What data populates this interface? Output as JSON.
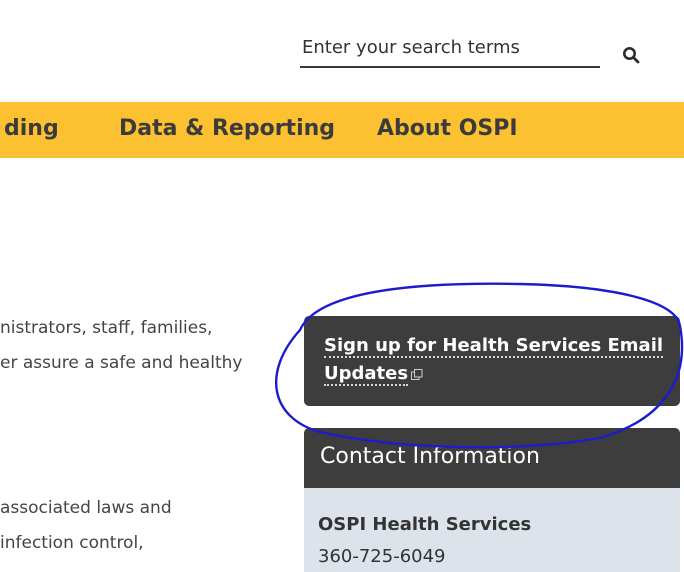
{
  "search": {
    "placeholder": "Enter your search terms",
    "icon": "search-icon"
  },
  "nav": {
    "items": [
      {
        "label": "ding"
      },
      {
        "label": "Data & Reporting"
      },
      {
        "label": "About OSPI"
      }
    ],
    "background": "#fcc131"
  },
  "body_text": [
    "nistrators, staff, families,",
    "er assure a safe and healthy",
    "associated laws and",
    " infection control,"
  ],
  "signup": {
    "line1": "Sign up for Health Services Email",
    "line2": "Updates",
    "icon": "external-link-icon"
  },
  "contact": {
    "title": "Contact Information",
    "org": "OSPI Health Services",
    "phone": "360-725-6049"
  },
  "colors": {
    "panel_dark": "#3d3d3d",
    "contact_body": "#dde3ea",
    "annotation_ink": "#1c1ccc"
  }
}
